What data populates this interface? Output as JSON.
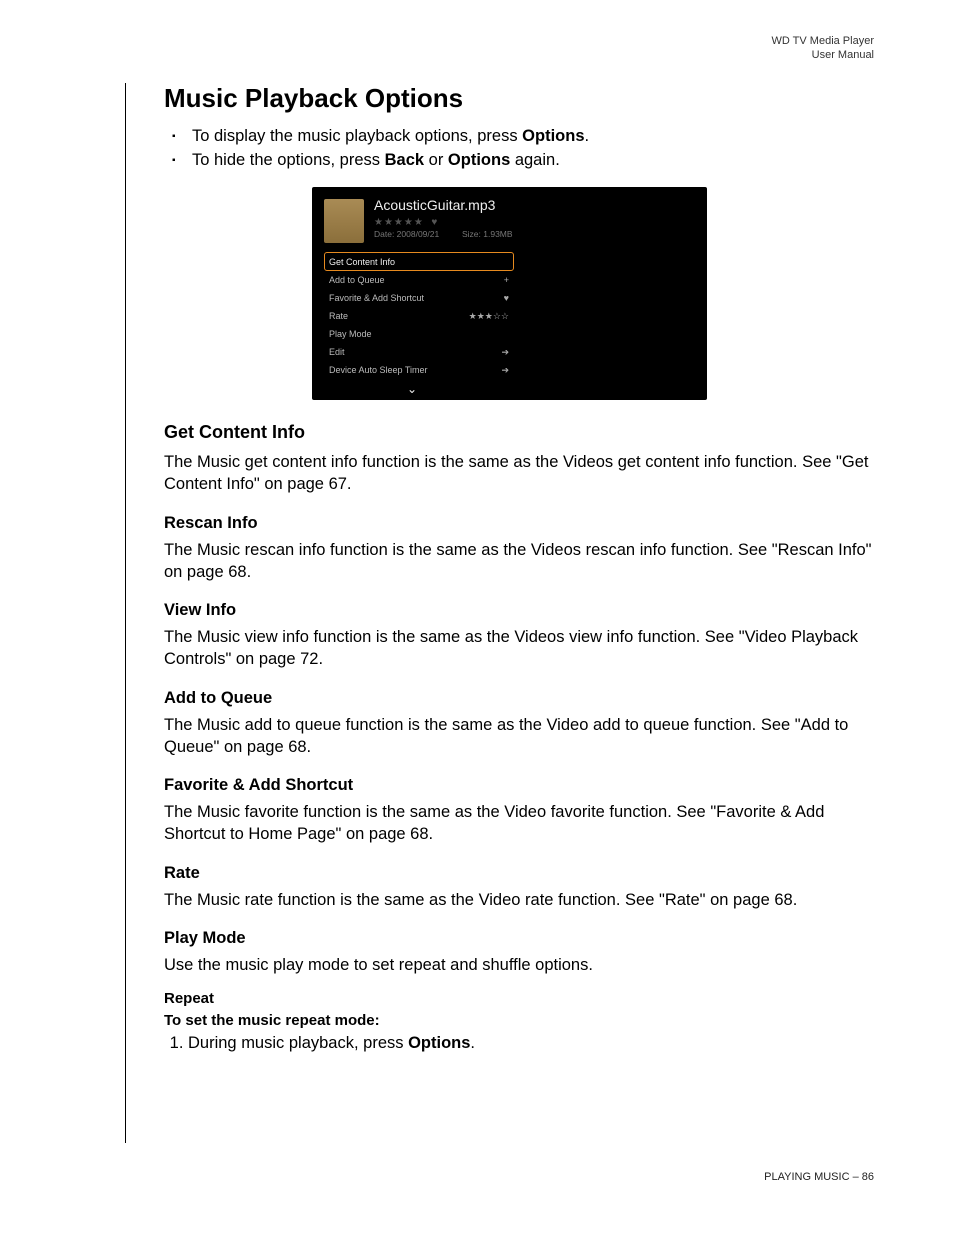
{
  "header": {
    "line1": "WD TV Media Player",
    "line2": "User Manual"
  },
  "title": "Music Playback Options",
  "bullets": {
    "item1_pre": "To display the music playback options, press ",
    "item1_bold": "Options",
    "item1_post": ".",
    "item2_pre": "To hide the options, press ",
    "item2_bold1": "Back",
    "item2_mid": " or ",
    "item2_bold2": "Options",
    "item2_post": " again."
  },
  "screenshot": {
    "filename": "AcousticGuitar.mp3",
    "date_label": "Date: 2008/09/21",
    "size_label": "Size: 1.93MB",
    "menu": [
      {
        "label": "Get Content Info",
        "icon": ""
      },
      {
        "label": "Add to Queue",
        "icon": "+"
      },
      {
        "label": "Favorite & Add Shortcut",
        "icon": "♥"
      },
      {
        "label": "Rate",
        "icon": "★★★☆☆"
      },
      {
        "label": "Play Mode",
        "icon": ""
      },
      {
        "label": "Edit",
        "icon": "➔"
      },
      {
        "label": "Device Auto Sleep Timer",
        "icon": "➔"
      }
    ]
  },
  "sections": {
    "get_content_info": {
      "heading": "Get Content Info",
      "body": "The Music get content info function is the same as the Videos get content info function. See \"Get Content Info\" on page 67."
    },
    "rescan_info": {
      "heading": "Rescan Info",
      "body": "The Music rescan info function is the same as the Videos rescan info function. See \"Rescan Info\" on page 68."
    },
    "view_info": {
      "heading": "View Info",
      "body": "The Music view info function is the same as the Videos view info function. See \"Video Playback Controls\" on page 72."
    },
    "add_to_queue": {
      "heading": "Add to Queue",
      "body": "The Music add to queue function is the same as the Video add to queue function. See \"Add to Queue\" on page 68."
    },
    "favorite": {
      "heading": "Favorite & Add Shortcut",
      "body": "The Music favorite function is the same as the Video favorite function. See \"Favorite & Add Shortcut to Home Page\" on page 68."
    },
    "rate": {
      "heading": "Rate",
      "body": "The Music rate function is the same as the Video rate function. See \"Rate\" on page 68."
    },
    "play_mode": {
      "heading": "Play Mode",
      "body": "Use the music play mode to set repeat and shuffle options."
    },
    "repeat": {
      "heading": "Repeat",
      "subtitle": "To set the music repeat mode:",
      "step1_pre": "During music playback, press ",
      "step1_bold": "Options",
      "step1_post": "."
    }
  },
  "footer": {
    "section": "PLAYING MUSIC",
    "sep": " – ",
    "page": "86"
  }
}
